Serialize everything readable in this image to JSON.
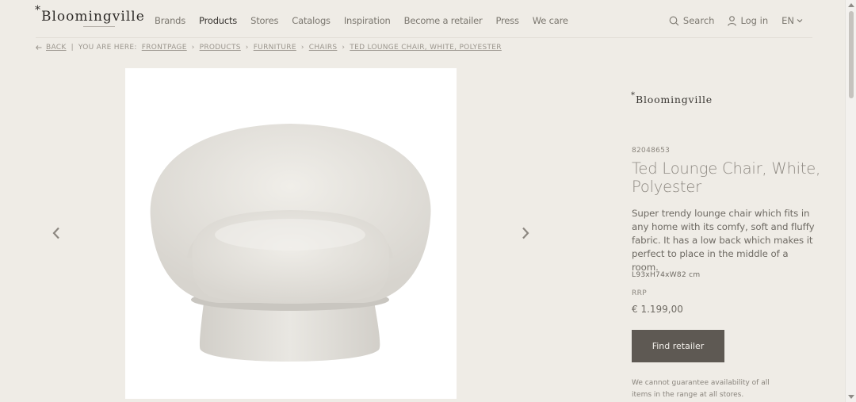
{
  "header": {
    "logo_star": "*",
    "logo_text": "Bloomingville",
    "nav": [
      "Brands",
      "Products",
      "Stores",
      "Catalogs",
      "Inspiration",
      "Become a retailer",
      "Press",
      "We care"
    ],
    "search_label": "Search",
    "login_label": "Log in",
    "lang_label": "EN"
  },
  "breadcrumb": {
    "back_label": "BACK",
    "prefix": "YOU ARE HERE:",
    "items": [
      "FRONTPAGE",
      "PRODUCTS",
      "FURNITURE",
      "CHAIRS",
      "TED LOUNGE CHAIR, WHITE, POLYESTER"
    ]
  },
  "product": {
    "brand_star": "*",
    "brand": "Bloomingville",
    "sku": "82048653",
    "title": "Ted Lounge Chair, White, Polyester",
    "description": "Super trendy lounge chair which fits in any home with its comfy, soft and fluffy fabric. It has a low back which makes it perfect to place in the middle of a room.",
    "dimensions": "L93xH74xW82 cm",
    "rrp_label": "RRP",
    "price": "€ 1.199,00",
    "find_retailer_label": "Find retailer",
    "availability_note": "We cannot guarantee availability of all items in the range at all stores."
  },
  "colors": {
    "background": "#efece6",
    "button": "#5e5953"
  }
}
